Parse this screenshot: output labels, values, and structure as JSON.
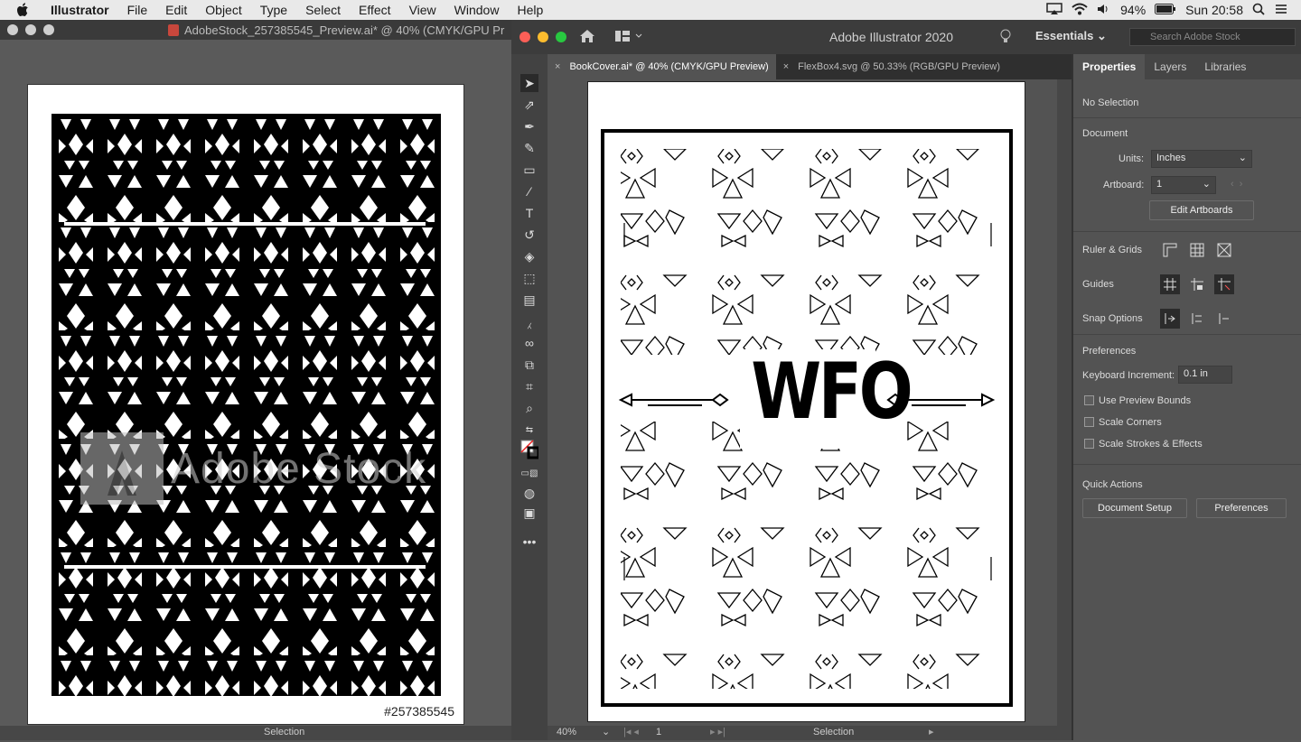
{
  "menubar": {
    "app": "Illustrator",
    "items": [
      "File",
      "Edit",
      "Object",
      "Type",
      "Select",
      "Effect",
      "View",
      "Window",
      "Help"
    ],
    "battery": "94%",
    "clock": "Sun 20:58"
  },
  "left_window": {
    "title": "AdobeStock_257385545_Preview.ai* @ 40% (CMYK/GPU Pr",
    "watermark": "Adobe Stock",
    "stock_number": "#257385545",
    "status_tool": "Selection"
  },
  "right_window": {
    "app_title": "Adobe Illustrator 2020",
    "workspace": "Essentials",
    "search_placeholder": "Search Adobe Stock",
    "tabs": [
      {
        "label": "BookCover.ai* @ 40% (CMYK/GPU Preview)",
        "active": true
      },
      {
        "label": "FlexBox4.svg @ 50.33% (RGB/GPU Preview)",
        "active": false
      }
    ],
    "artwork_text": "WFO",
    "zoom": "40%",
    "artboard_number": "1",
    "status_tool": "Selection"
  },
  "properties_panel": {
    "tabs": [
      "Properties",
      "Layers",
      "Libraries"
    ],
    "selection": "No Selection",
    "document_heading": "Document",
    "units_label": "Units:",
    "units_value": "Inches",
    "artboard_label": "Artboard:",
    "artboard_value": "1",
    "edit_artboards": "Edit Artboards",
    "ruler_grids": "Ruler & Grids",
    "guides": "Guides",
    "snap_options": "Snap Options",
    "preferences_heading": "Preferences",
    "keyboard_increment_label": "Keyboard Increment:",
    "keyboard_increment_value": "0.1 in",
    "checkboxes": [
      "Use Preview Bounds",
      "Scale Corners",
      "Scale Strokes & Effects"
    ],
    "quick_actions": "Quick Actions",
    "document_setup": "Document Setup",
    "preferences_button": "Preferences"
  }
}
